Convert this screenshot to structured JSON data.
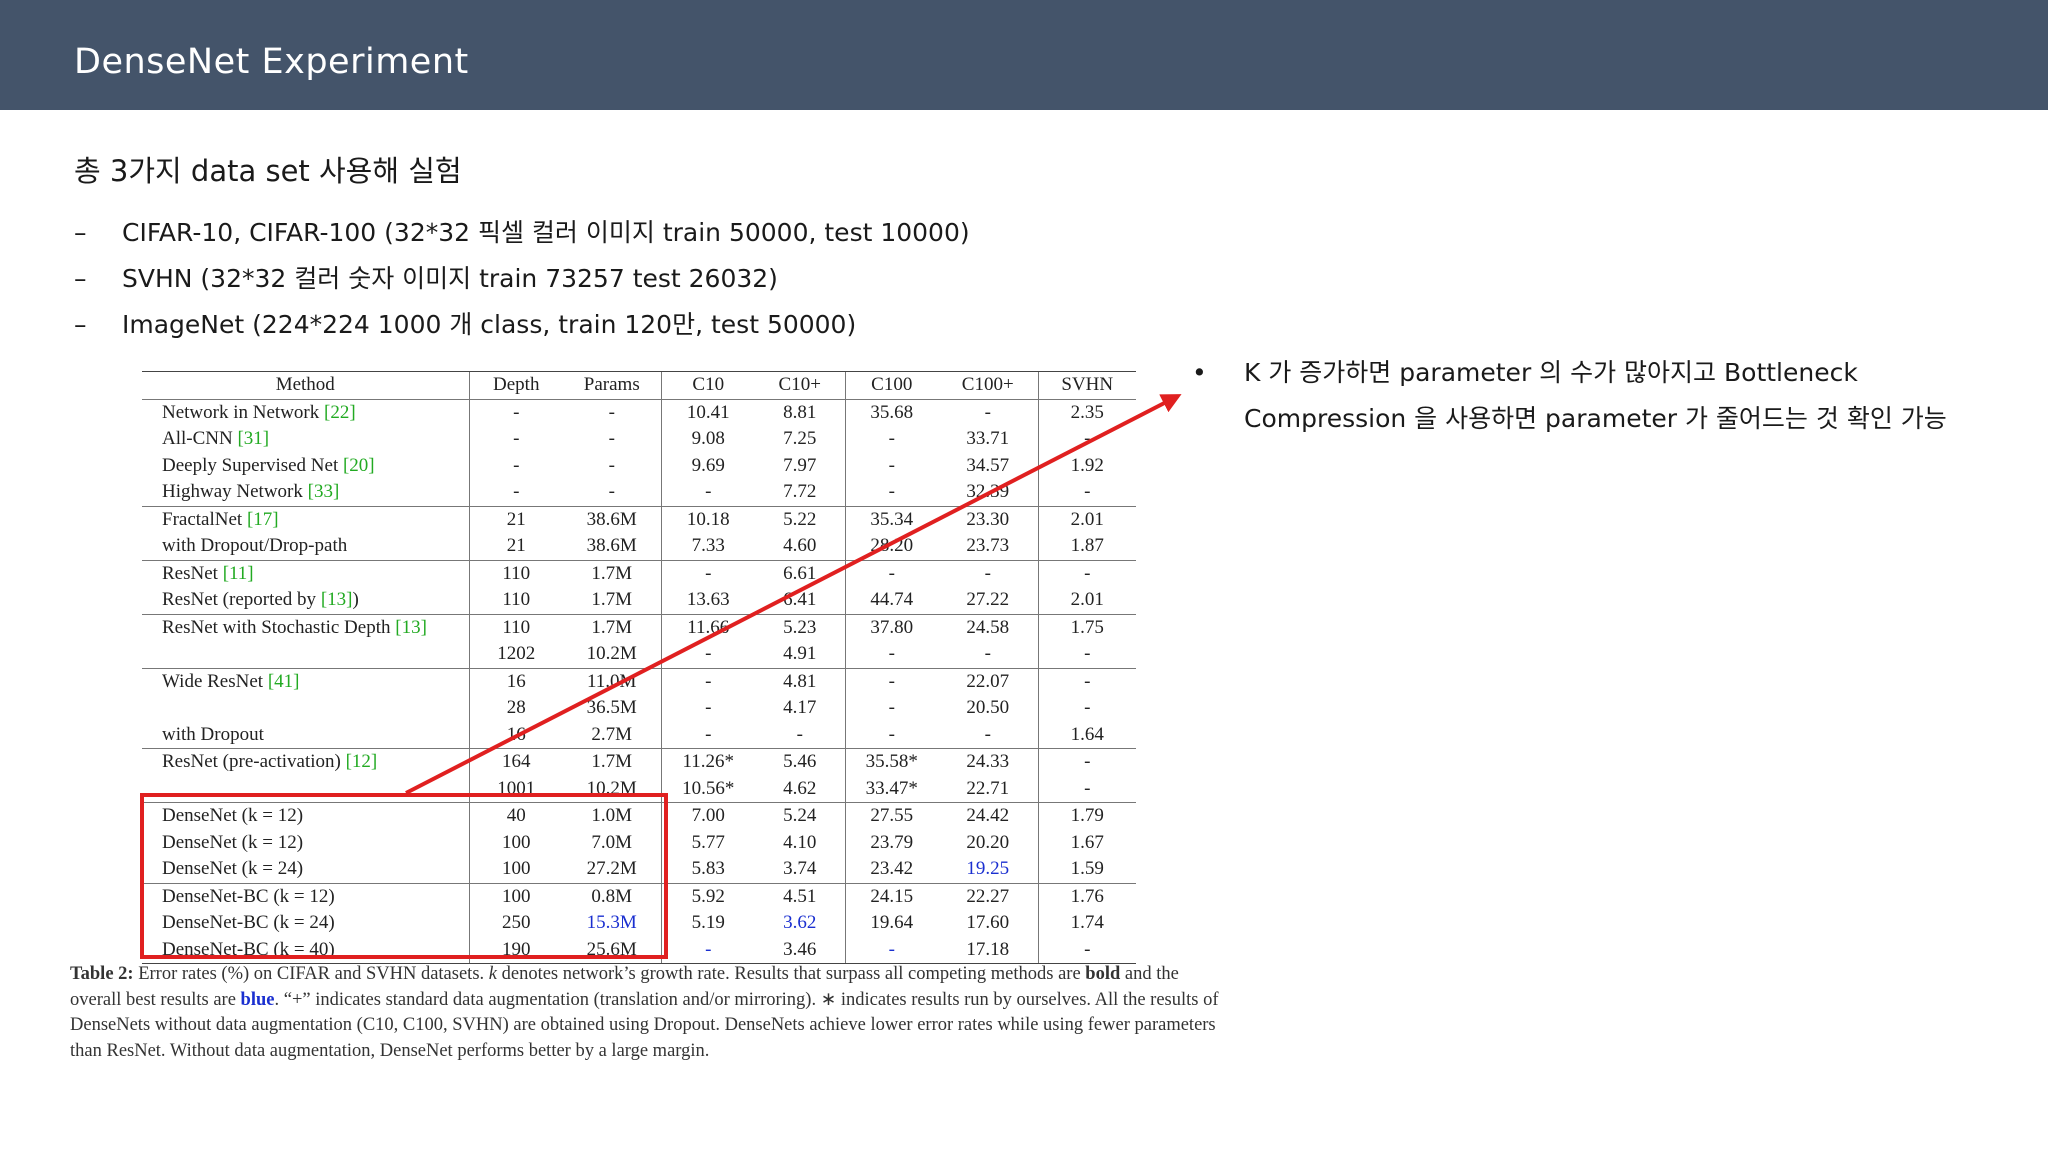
{
  "slide": {
    "title": "DenseNet Experiment",
    "heading": "총 3가지 data set 사용해 실험",
    "bullet_marker": "–",
    "bullets": [
      "CIFAR-10, CIFAR-100 (32*32 픽셀 컬러 이미지 train 50000, test 10000)",
      "SVHN (32*32 컬러 숫자 이미지 train 73257 test 26032)",
      "ImageNet (224*224 1000 개 class, train 120만, test 50000)"
    ],
    "note_marker": "•",
    "note_line1": "K 가 증가하면 parameter 의 수가 많아지고 Bottleneck",
    "note_line2": "Compression 을 사용하면 parameter 가 줄어드는 것 확인 가능",
    "highlight_color": "#e02020"
  },
  "table": {
    "headers": [
      "Method",
      "Depth",
      "Params",
      "C10",
      "C10+",
      "C100",
      "C100+",
      "SVHN"
    ],
    "rows": [
      {
        "name": "Network in Network ",
        "ref": "[22]",
        "cells": [
          "-",
          "-",
          "10.41",
          "8.81",
          "35.68",
          "-",
          "2.35"
        ]
      },
      {
        "name": "All-CNN ",
        "ref": "[31]",
        "cells": [
          "-",
          "-",
          "9.08",
          "7.25",
          "-",
          "33.71",
          "-"
        ]
      },
      {
        "name": "Deeply Supervised Net ",
        "ref": "[20]",
        "cells": [
          "-",
          "-",
          "9.69",
          "7.97",
          "-",
          "34.57",
          "1.92"
        ]
      },
      {
        "name": "Highway Network ",
        "ref": "[33]",
        "cells": [
          "-",
          "-",
          "-",
          "7.72",
          "-",
          "32.39",
          "-"
        ]
      },
      {
        "name": "FractalNet ",
        "ref": "[17]",
        "cells": [
          "21",
          "38.6M",
          "10.18",
          "5.22",
          "35.34",
          "23.30",
          "2.01"
        ]
      },
      {
        "name": "with Dropout/Drop-path",
        "ref": "",
        "cells": [
          "21",
          "38.6M",
          "7.33",
          "4.60",
          "28.20",
          "23.73",
          "1.87"
        ]
      },
      {
        "name": "ResNet ",
        "ref": "[11]",
        "cells": [
          "110",
          "1.7M",
          "-",
          "6.61",
          "-",
          "-",
          "-"
        ]
      },
      {
        "name": "ResNet (reported by ",
        "ref": "[13]",
        "suffix": ")",
        "cells": [
          "110",
          "1.7M",
          "13.63",
          "6.41",
          "44.74",
          "27.22",
          "2.01"
        ]
      },
      {
        "name": "ResNet with Stochastic Depth ",
        "ref": "[13]",
        "cells": [
          "110",
          "1.7M",
          "11.66",
          "5.23",
          "37.80",
          "24.58",
          "1.75"
        ]
      },
      {
        "name": "",
        "ref": "",
        "cells": [
          "1202",
          "10.2M",
          "-",
          "4.91",
          "-",
          "-",
          "-"
        ]
      },
      {
        "name": "Wide ResNet ",
        "ref": "[41]",
        "cells": [
          "16",
          "11.0M",
          "-",
          "4.81",
          "-",
          "22.07",
          "-"
        ]
      },
      {
        "name": "",
        "ref": "",
        "cells": [
          "28",
          "36.5M",
          "-",
          "4.17",
          "-",
          "20.50",
          "-"
        ]
      },
      {
        "name": "with Dropout",
        "ref": "",
        "cells": [
          "16",
          "2.7M",
          "-",
          "-",
          "-",
          "-",
          "1.64"
        ]
      },
      {
        "name": "ResNet (pre-activation) ",
        "ref": "[12]",
        "cells": [
          "164",
          "1.7M",
          "11.26*",
          "5.46",
          "35.58*",
          "24.33",
          "-"
        ]
      },
      {
        "name": "",
        "ref": "",
        "cells": [
          "1001",
          "10.2M",
          "10.56*",
          "4.62",
          "33.47*",
          "22.71",
          "-"
        ]
      },
      {
        "name": "DenseNet (k = 12)",
        "ref": "",
        "cells": [
          "40",
          "1.0M",
          "7.00",
          "5.24",
          "27.55",
          "24.42",
          "1.79"
        ]
      },
      {
        "name": "DenseNet (k = 12)",
        "ref": "",
        "cells": [
          "100",
          "7.0M",
          "5.77",
          "4.10",
          "23.79",
          "20.20",
          "1.67"
        ]
      },
      {
        "name": "DenseNet (k = 24)",
        "ref": "",
        "cells": [
          "100",
          "27.2M",
          "5.83",
          "3.74",
          "23.42",
          "19.25",
          "1.59"
        ]
      },
      {
        "name": "DenseNet-BC (k = 12)",
        "ref": "",
        "cells": [
          "100",
          "0.8M",
          "5.92",
          "4.51",
          "24.15",
          "22.27",
          "1.76"
        ]
      },
      {
        "name": "DenseNet-BC (k = 24)",
        "ref": "",
        "cells": [
          "250",
          "15.3M",
          "5.19",
          "3.62",
          "19.64",
          "17.60",
          "1.74"
        ]
      },
      {
        "name": "DenseNet-BC (k = 40)",
        "ref": "",
        "cells": [
          "190",
          "25.6M",
          "-",
          "3.46",
          "-",
          "17.18",
          "-"
        ]
      }
    ],
    "bold_cells": [
      "15-2",
      "15-4",
      "16-2",
      "16-3",
      "16-5",
      "17-2",
      "17-3",
      "17-4",
      "17-5",
      "18-2",
      "18-4",
      "19-3",
      "19-5"
    ],
    "blue_cells": [
      "17-6",
      "19-2",
      "19-4",
      "20-3",
      "20-5"
    ]
  },
  "caption": {
    "label": "Table 2:",
    "t1": " Error rates (%) on CIFAR and SVHN datasets. ",
    "k": "k",
    "t2": " denotes network’s growth rate. Results that surpass all competing methods are ",
    "bold_word": "bold",
    "t3": " and the overall best results are ",
    "blue_word": "blue",
    "t4": ". “+” indicates standard data augmentation (translation and/or mirroring). ∗ indicates results run by ourselves. All the results of DenseNets without data augmentation (C10, C100, SVHN) are obtained using Dropout. DenseNets achieve lower error rates while using fewer parameters than ResNet. Without data augmentation, DenseNet performs better by a large margin."
  }
}
